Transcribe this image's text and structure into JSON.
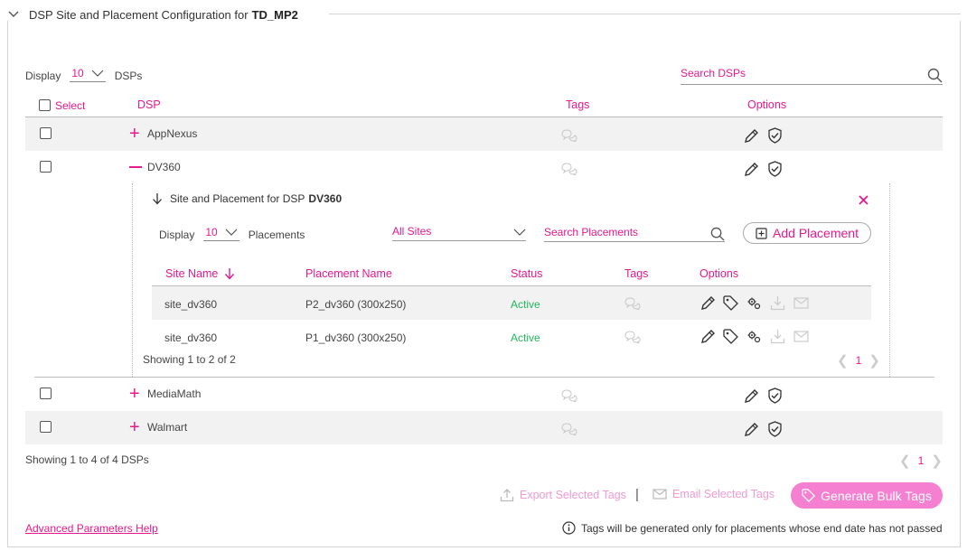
{
  "header": {
    "title": "DSP Site and Placement Configuration for",
    "target": "TD_MP2"
  },
  "dsp_list": {
    "display_label": "Display",
    "page_size": "10",
    "unit": "DSPs",
    "search_placeholder": "Search DSPs",
    "columns": {
      "select": "Select",
      "dsp": "DSP",
      "tags": "Tags",
      "options": "Options"
    },
    "rows": [
      {
        "name": "AppNexus",
        "expanded": false
      },
      {
        "name": "DV360",
        "expanded": true
      },
      {
        "name": "MediaMath",
        "expanded": false
      },
      {
        "name": "Walmart",
        "expanded": false
      }
    ],
    "showing": "Showing 1 to 4 of 4 DSPs",
    "page": "1"
  },
  "placements": {
    "title_prefix": "Site and Placement for DSP",
    "dsp_name": "DV360",
    "display_label": "Display",
    "page_size": "10",
    "unit": "Placements",
    "site_filter": "All Sites",
    "search_placeholder": "Search Placements",
    "add_button": "Add Placement",
    "columns": {
      "site": "Site Name",
      "placement": "Placement Name",
      "status": "Status",
      "tags": "Tags",
      "options": "Options"
    },
    "rows": [
      {
        "site": "site_dv360",
        "placement": "P2_dv360 (300x250)",
        "status": "Active"
      },
      {
        "site": "site_dv360",
        "placement": "P1_dv360 (300x250)",
        "status": "Active"
      }
    ],
    "showing": "Showing 1 to 2 of 2",
    "page": "1"
  },
  "footer": {
    "export_tags": "Export Selected Tags",
    "separator": "|",
    "email_tags": "Email Selected Tags",
    "generate": "Generate Bulk Tags",
    "help_link": "Advanced Parameters Help",
    "notice": "Tags will be generated only for placements whose end date has not passed"
  },
  "colors": {
    "accent": "#e6198f",
    "active": "#1fb75c",
    "button_bg": "#f57fd0"
  }
}
